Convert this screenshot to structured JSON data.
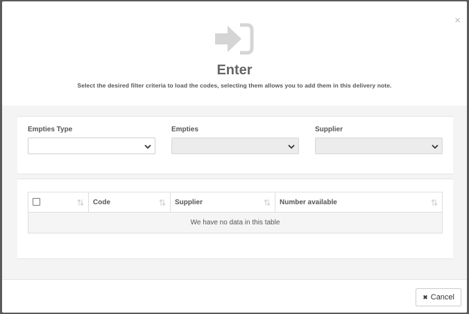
{
  "dialog": {
    "close_symbol": "×",
    "icon": "sign-in-arrow-icon",
    "title": "Enter",
    "subtitle": "Select the desired filter criteria to load the codes, selecting them allows you to add them in this delivery note."
  },
  "filters": {
    "empties_type": {
      "label": "Empties Type",
      "value": ""
    },
    "empties": {
      "label": "Empties",
      "value": ""
    },
    "supplier": {
      "label": "Supplier",
      "value": ""
    }
  },
  "table": {
    "columns": [
      "",
      "Code",
      "Supplier",
      "Number available"
    ],
    "empty_message": "We have no data in this table"
  },
  "footer": {
    "cancel_label": "Cancel",
    "cancel_symbol": "✖"
  }
}
